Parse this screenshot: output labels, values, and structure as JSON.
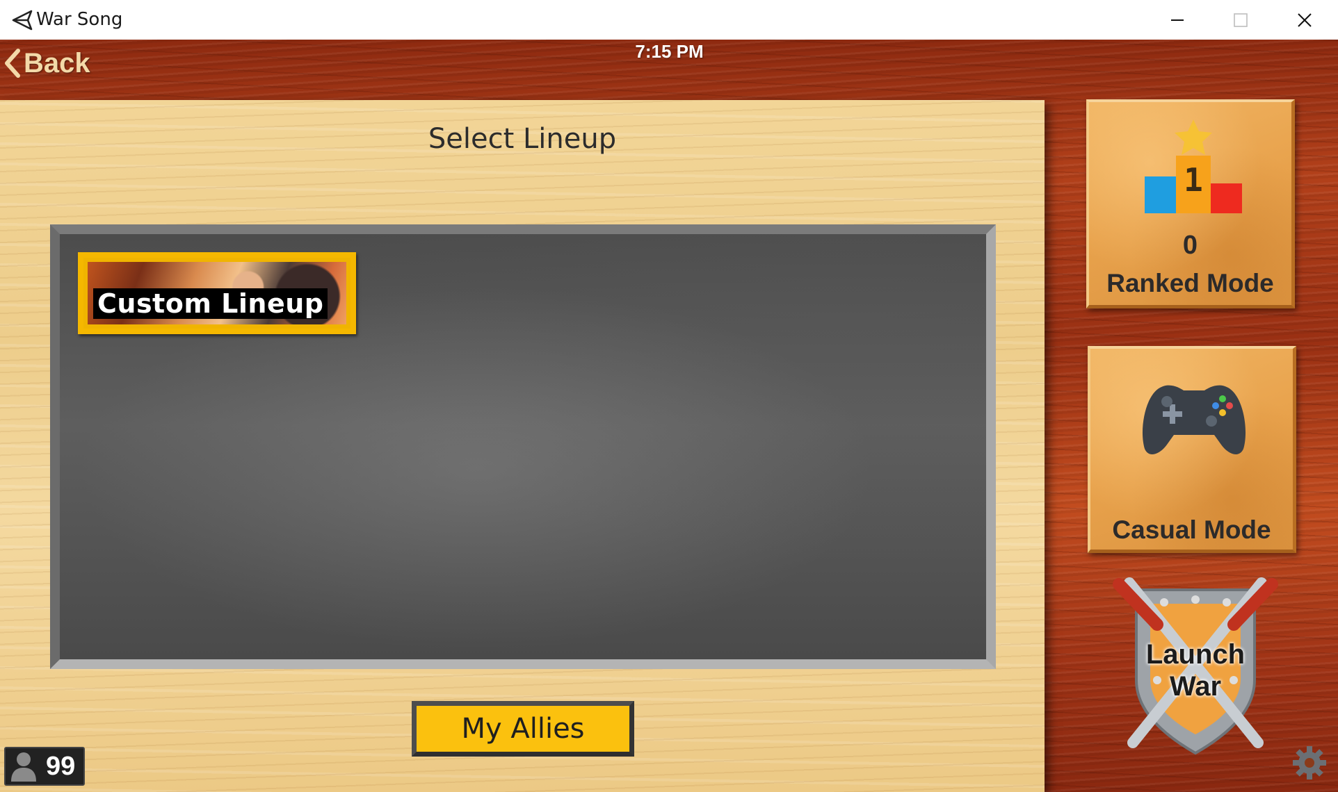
{
  "window": {
    "title": "War Song",
    "icons": {
      "app": "unity-logo-icon",
      "minimize": "minimize-icon",
      "maximize": "maximize-icon",
      "close": "close-icon"
    }
  },
  "header": {
    "back_label": "Back",
    "back_icon": "chevron-left-icon",
    "clock": "7:15 PM"
  },
  "panel": {
    "title": "Select Lineup",
    "lineups": [
      {
        "label": "Custom Lineup"
      }
    ],
    "allies_label": "My Allies"
  },
  "player_count": {
    "icon": "person-icon",
    "value": "99"
  },
  "modes": {
    "ranked": {
      "icon": "podium-star-icon",
      "podium_number": "1",
      "count": "0",
      "label": "Ranked Mode"
    },
    "casual": {
      "icon": "gamepad-icon",
      "label": "Casual Mode"
    }
  },
  "launch": {
    "icon": "crossed-swords-shield-icon",
    "line1": "Launch",
    "line2": "War"
  },
  "settings": {
    "icon": "gear-icon"
  },
  "colors": {
    "accent_yellow": "#fbc10e",
    "wood_red": "#a13416",
    "panel_wood": "#f0d293",
    "board_gray": "#555555"
  }
}
